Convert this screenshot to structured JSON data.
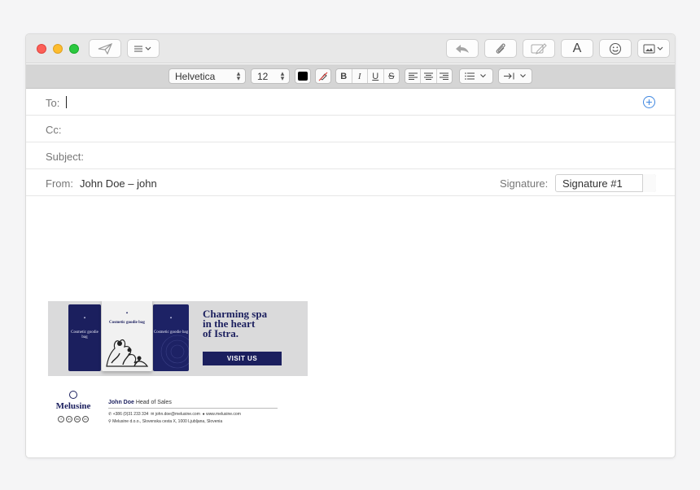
{
  "toolbar": {
    "send_icon": "send-paper-plane-icon",
    "header_fields_icon": "list-chevron-icon",
    "reply_icon": "reply-arrow-icon",
    "attach_icon": "paperclip-icon",
    "markup_icon": "markup-pencil-icon",
    "font_icon_label": "A",
    "emoji_icon": "smiley-icon",
    "photo_icon": "photo-browser-icon"
  },
  "format": {
    "font_name": "Helvetica",
    "font_size": "12",
    "text_color": "#000000",
    "bold": "B",
    "italic": "I",
    "underline": "U",
    "strike": "S",
    "align_icons": [
      "align-left-icon",
      "align-center-icon",
      "align-right-icon"
    ],
    "list_icon": "bulleted-list-icon",
    "indent_icon": "indent-icon"
  },
  "fields": {
    "to_label": "To:",
    "cc_label": "Cc:",
    "subject_label": "Subject:",
    "from_label": "From:",
    "from_value": "John Doe – john",
    "signature_label": "Signature:",
    "signature_value": "Signature #1"
  },
  "banner": {
    "bag_left_text": "Cosmetic goodie bag",
    "bag_center_text": "Cosmetic goodie bag",
    "bag_right_text": "Cosmetic goodie bag",
    "headline_1": "Charming spa",
    "headline_2": "in the heart",
    "headline_3": "of Istra.",
    "cta": "VISIT US"
  },
  "signature": {
    "logo": "Melusine",
    "name": "John Doe",
    "title": "Head of Sales",
    "phone": "+386 (0)31 233 334",
    "email": "john.doe@melusine.com",
    "website": "www.melusine.com",
    "address": "Melusine d.o.o., Slovenska cesta X, 1000 Ljubljana, Slovenia",
    "socials": [
      "f",
      "in",
      "tw",
      "in"
    ]
  },
  "colors": {
    "brand_navy": "#1b1f5e",
    "accent_blue": "#3e86e0",
    "close": "#fc5f57",
    "minimize": "#fdbc2e",
    "zoom": "#2ac83f"
  }
}
